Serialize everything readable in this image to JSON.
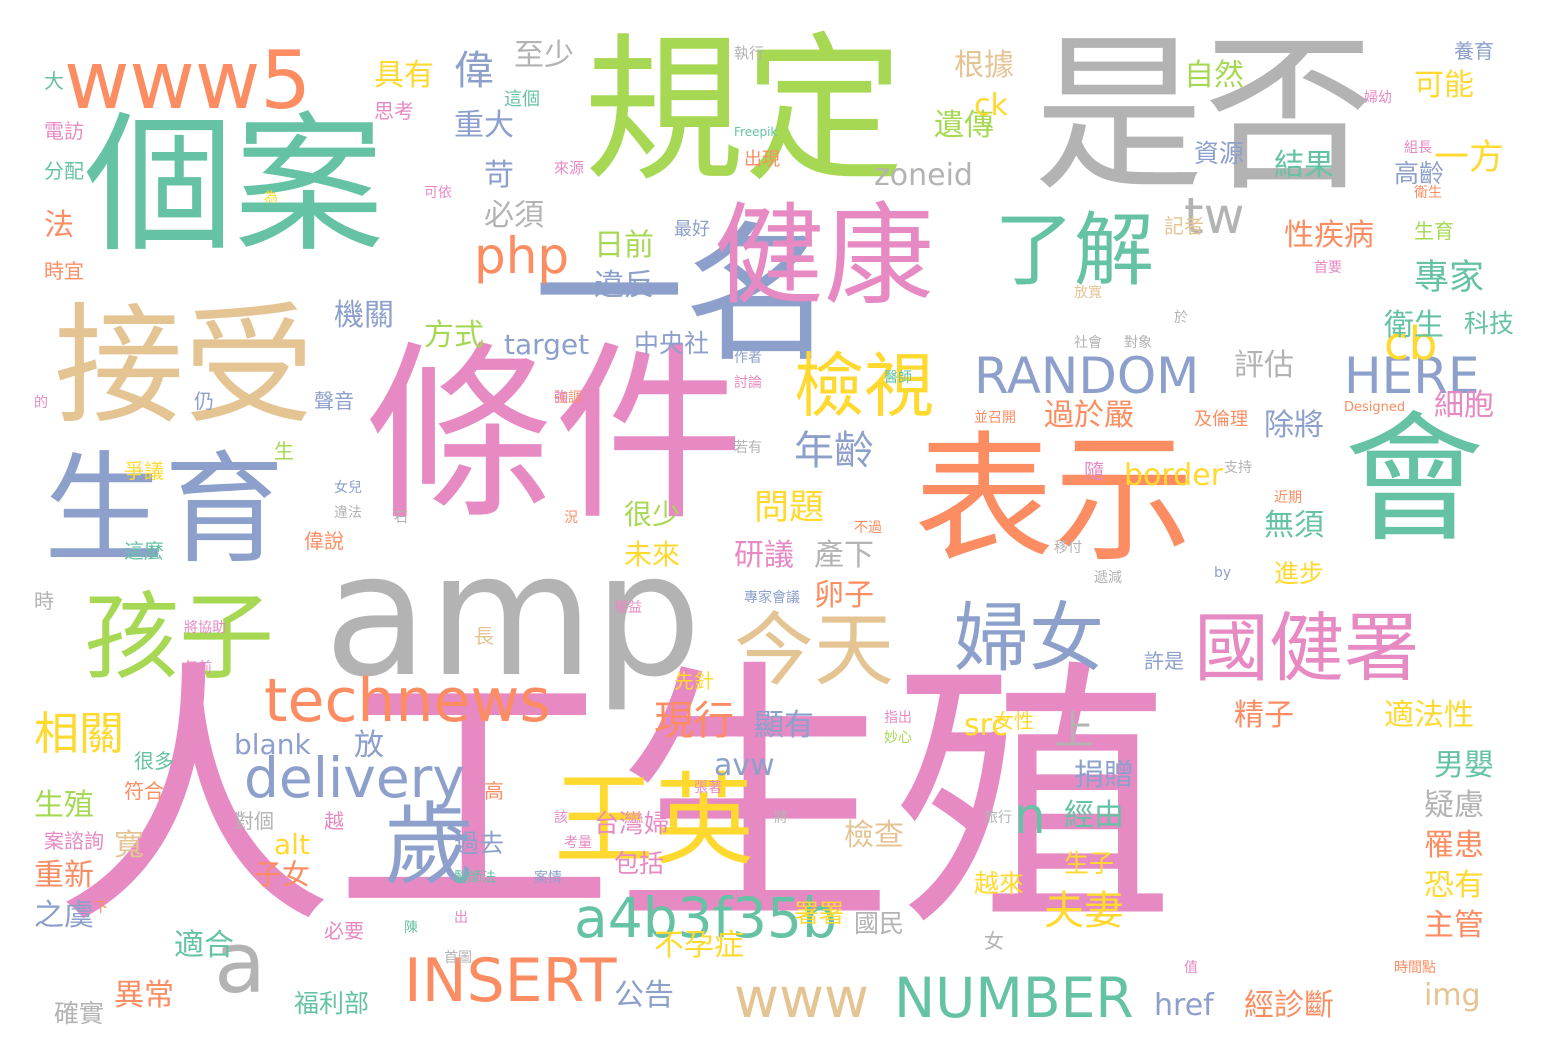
{
  "palette": {
    "pink": "#e78ac3",
    "green": "#66c2a5",
    "orange": "#fc8d62",
    "blue": "#8da0cb",
    "lime": "#a6d854",
    "yellow": "#ffd92f",
    "tan": "#e5c494",
    "gray": "#b3b3b3"
  },
  "words": [
    {
      "text": "人工生殖",
      "color": "pink"
    },
    {
      "text": "條件",
      "color": "pink"
    },
    {
      "text": "規定",
      "color": "lime"
    },
    {
      "text": "是否",
      "color": "gray"
    },
    {
      "text": "個案",
      "color": "green"
    },
    {
      "text": "表示",
      "color": "orange"
    },
    {
      "text": "會",
      "color": "green"
    },
    {
      "text": "amp",
      "color": "gray"
    },
    {
      "text": "一名",
      "color": "blue"
    },
    {
      "text": "接受",
      "color": "tan"
    },
    {
      "text": "生育",
      "color": "blue"
    },
    {
      "text": "健康",
      "color": "pink"
    },
    {
      "text": "王英",
      "color": "yellow"
    },
    {
      "text": "孩子",
      "color": "lime"
    },
    {
      "text": "www5",
      "color": "orange"
    },
    {
      "text": "了解",
      "color": "green"
    },
    {
      "text": "今天",
      "color": "tan"
    },
    {
      "text": "婦女",
      "color": "blue"
    },
    {
      "text": "國健署",
      "color": "pink"
    },
    {
      "text": "歲",
      "color": "blue"
    },
    {
      "text": "檢視",
      "color": "yellow"
    },
    {
      "text": "technews",
      "color": "orange"
    },
    {
      "text": "delivery",
      "color": "blue"
    },
    {
      "text": "a4b3f35b",
      "color": "green"
    },
    {
      "text": "a",
      "color": "gray"
    },
    {
      "text": "INSERT",
      "color": "orange"
    },
    {
      "text": "NUMBER",
      "color": "green"
    },
    {
      "text": "www",
      "color": "tan"
    },
    {
      "text": "RANDOM",
      "color": "blue"
    },
    {
      "text": "php",
      "color": "orange"
    },
    {
      "text": "tw",
      "color": "gray"
    },
    {
      "text": "HERE",
      "color": "blue"
    },
    {
      "text": "cb",
      "color": "yellow"
    },
    {
      "text": "n",
      "color": "green"
    },
    {
      "text": "夫妻",
      "color": "yellow"
    },
    {
      "text": "zoneid",
      "color": "gray"
    },
    {
      "text": "年齡",
      "color": "blue"
    },
    {
      "text": "相關",
      "color": "yellow"
    },
    {
      "text": "現行",
      "color": "orange"
    },
    {
      "text": "上",
      "color": "gray"
    },
    {
      "text": "偉",
      "color": "blue"
    },
    {
      "text": "具有",
      "color": "yellow"
    },
    {
      "text": "至少",
      "color": "gray"
    },
    {
      "text": "重大",
      "color": "blue"
    },
    {
      "text": "苛",
      "color": "blue"
    },
    {
      "text": "必須",
      "color": "gray"
    },
    {
      "text": "日前",
      "color": "lime"
    },
    {
      "text": "違反",
      "color": "blue"
    },
    {
      "text": "機關",
      "color": "blue"
    },
    {
      "text": "方式",
      "color": "lime"
    },
    {
      "text": "target",
      "color": "blue"
    },
    {
      "text": "中央社",
      "color": "blue"
    },
    {
      "text": "根據",
      "color": "tan"
    },
    {
      "text": "自然",
      "color": "lime"
    },
    {
      "text": "遺傳",
      "color": "lime"
    },
    {
      "text": "ck",
      "color": "yellow"
    },
    {
      "text": "可能",
      "color": "yellow"
    },
    {
      "text": "一方",
      "color": "yellow"
    },
    {
      "text": "結果",
      "color": "green"
    },
    {
      "text": "資源",
      "color": "blue"
    },
    {
      "text": "高齡",
      "color": "blue"
    },
    {
      "text": "專家",
      "color": "green"
    },
    {
      "text": "衛生",
      "color": "green"
    },
    {
      "text": "性疾病",
      "color": "orange"
    },
    {
      "text": "科技",
      "color": "green"
    },
    {
      "text": "評估",
      "color": "gray"
    },
    {
      "text": "細胞",
      "color": "pink"
    },
    {
      "text": "過於嚴",
      "color": "orange"
    },
    {
      "text": "除將",
      "color": "blue"
    },
    {
      "text": "border",
      "color": "yellow"
    },
    {
      "text": "無須",
      "color": "green"
    },
    {
      "text": "進步",
      "color": "yellow"
    },
    {
      "text": "問題",
      "color": "yellow"
    },
    {
      "text": "研議",
      "color": "pink"
    },
    {
      "text": "產下",
      "color": "gray"
    },
    {
      "text": "卵子",
      "color": "orange"
    },
    {
      "text": "很少",
      "color": "lime"
    },
    {
      "text": "未來",
      "color": "yellow"
    },
    {
      "text": "顯有",
      "color": "blue"
    },
    {
      "text": "avw",
      "color": "blue"
    },
    {
      "text": "src",
      "color": "yellow"
    },
    {
      "text": "精子",
      "color": "orange"
    },
    {
      "text": "適法性",
      "color": "yellow"
    },
    {
      "text": "男嬰",
      "color": "green"
    },
    {
      "text": "捐贈",
      "color": "blue"
    },
    {
      "text": "疑慮",
      "color": "gray"
    },
    {
      "text": "經由",
      "color": "green"
    },
    {
      "text": "罹患",
      "color": "orange"
    },
    {
      "text": "恐有",
      "color": "yellow"
    },
    {
      "text": "主管",
      "color": "orange"
    },
    {
      "text": "生子",
      "color": "yellow"
    },
    {
      "text": "檢查",
      "color": "tan"
    },
    {
      "text": "alt",
      "color": "yellow"
    },
    {
      "text": "子女",
      "color": "orange"
    },
    {
      "text": "blank",
      "color": "blue"
    },
    {
      "text": "放",
      "color": "blue"
    },
    {
      "text": "台灣婦",
      "color": "pink"
    },
    {
      "text": "生殖",
      "color": "lime"
    },
    {
      "text": "寬",
      "color": "tan"
    },
    {
      "text": "重新",
      "color": "orange"
    },
    {
      "text": "之虞",
      "color": "blue"
    },
    {
      "text": "適合",
      "color": "green"
    },
    {
      "text": "異常",
      "color": "orange"
    },
    {
      "text": "福利部",
      "color": "green"
    },
    {
      "text": "確實",
      "color": "gray"
    },
    {
      "text": "不孕症",
      "color": "yellow"
    },
    {
      "text": "公告",
      "color": "blue"
    },
    {
      "text": "國民",
      "color": "gray"
    },
    {
      "text": "href",
      "color": "blue"
    },
    {
      "text": "經診斷",
      "color": "orange"
    },
    {
      "text": "img",
      "color": "tan"
    },
    {
      "text": "過去",
      "color": "blue"
    },
    {
      "text": "包括",
      "color": "pink"
    },
    {
      "text": "署署",
      "color": "yellow"
    },
    {
      "text": "越來",
      "color": "yellow"
    },
    {
      "text": "必要",
      "color": "pink"
    },
    {
      "text": "大",
      "color": "green"
    },
    {
      "text": "電訪",
      "color": "pink"
    },
    {
      "text": "分配",
      "color": "green"
    },
    {
      "text": "法",
      "color": "orange"
    },
    {
      "text": "時宜",
      "color": "orange"
    },
    {
      "text": "思考",
      "color": "pink"
    },
    {
      "text": "這個",
      "color": "green"
    },
    {
      "text": "執行",
      "color": "gray"
    },
    {
      "text": "來源",
      "color": "pink"
    },
    {
      "text": "出現",
      "color": "orange"
    },
    {
      "text": "最好",
      "color": "blue"
    },
    {
      "text": "可依",
      "color": "pink"
    },
    {
      "text": "記者",
      "color": "tan"
    },
    {
      "text": "養育",
      "color": "blue"
    },
    {
      "text": "婦幼",
      "color": "pink"
    },
    {
      "text": "組長",
      "color": "pink"
    },
    {
      "text": "衛生",
      "color": "orange"
    },
    {
      "text": "生育",
      "color": "lime"
    },
    {
      "text": "Freepik",
      "color": "green"
    },
    {
      "text": "為",
      "color": "yellow"
    },
    {
      "text": "放寬",
      "color": "tan"
    },
    {
      "text": "首要",
      "color": "pink"
    },
    {
      "text": "醫師",
      "color": "green"
    },
    {
      "text": "社會",
      "color": "gray"
    },
    {
      "text": "對象",
      "color": "gray"
    },
    {
      "text": "於",
      "color": "gray"
    },
    {
      "text": "作者",
      "color": "blue"
    },
    {
      "text": "討論",
      "color": "pink"
    },
    {
      "text": "聲音",
      "color": "blue"
    },
    {
      "text": "仍",
      "color": "blue"
    },
    {
      "text": "強調",
      "color": "orange"
    },
    {
      "text": "並召開",
      "color": "orange"
    },
    {
      "text": "及倫理",
      "color": "orange"
    },
    {
      "text": "Designed",
      "color": "orange"
    },
    {
      "text": "爭議",
      "color": "yellow"
    },
    {
      "text": "生",
      "color": "lime"
    },
    {
      "text": "若有",
      "color": "gray"
    },
    {
      "text": "隨",
      "color": "pink"
    },
    {
      "text": "支持",
      "color": "gray"
    },
    {
      "text": "女兒",
      "color": "blue"
    },
    {
      "text": "違法",
      "color": "gray"
    },
    {
      "text": "偉說",
      "color": "orange"
    },
    {
      "text": "這麼",
      "color": "green"
    },
    {
      "text": "況",
      "color": "orange"
    },
    {
      "text": "不過",
      "color": "orange"
    },
    {
      "text": "近期",
      "color": "orange"
    },
    {
      "text": "移付",
      "color": "gray"
    },
    {
      "text": "時",
      "color": "gray"
    },
    {
      "text": "將協助",
      "color": "pink"
    },
    {
      "text": "權益",
      "color": "pink"
    },
    {
      "text": "專家會議",
      "color": "blue"
    },
    {
      "text": "遞減",
      "color": "gray"
    },
    {
      "text": "by",
      "color": "blue"
    },
    {
      "text": "長",
      "color": "tan"
    },
    {
      "text": "年前",
      "color": "pink"
    },
    {
      "text": "先針",
      "color": "yellow"
    },
    {
      "text": "許是",
      "color": "blue"
    },
    {
      "text": "指出",
      "color": "pink"
    },
    {
      "text": "妙心",
      "color": "lime"
    },
    {
      "text": "女性",
      "color": "yellow"
    },
    {
      "text": "很多",
      "color": "green"
    },
    {
      "text": "符合",
      "color": "orange"
    },
    {
      "text": "高",
      "color": "orange"
    },
    {
      "text": "張著",
      "color": "pink"
    },
    {
      "text": "對個",
      "color": "gray"
    },
    {
      "text": "越",
      "color": "pink"
    },
    {
      "text": "該",
      "color": "pink"
    },
    {
      "text": "考量",
      "color": "pink"
    },
    {
      "text": "將",
      "color": "gray"
    },
    {
      "text": "案諮詢",
      "color": "pink"
    },
    {
      "text": "旅行",
      "color": "gray"
    },
    {
      "text": "醫師法",
      "color": "green"
    },
    {
      "text": "案情",
      "color": "blue"
    },
    {
      "text": "下",
      "color": "orange"
    },
    {
      "text": "陳",
      "color": "green"
    },
    {
      "text": "首圖",
      "color": "gray"
    },
    {
      "text": "女",
      "color": "gray"
    },
    {
      "text": "時間點",
      "color": "orange"
    },
    {
      "text": "值",
      "color": "pink"
    },
    {
      "text": "出",
      "color": "pink"
    },
    {
      "text": "詢",
      "color": "pink"
    },
    {
      "text": "石",
      "color": "gray"
    },
    {
      "text": "的",
      "color": "pink"
    }
  ]
}
